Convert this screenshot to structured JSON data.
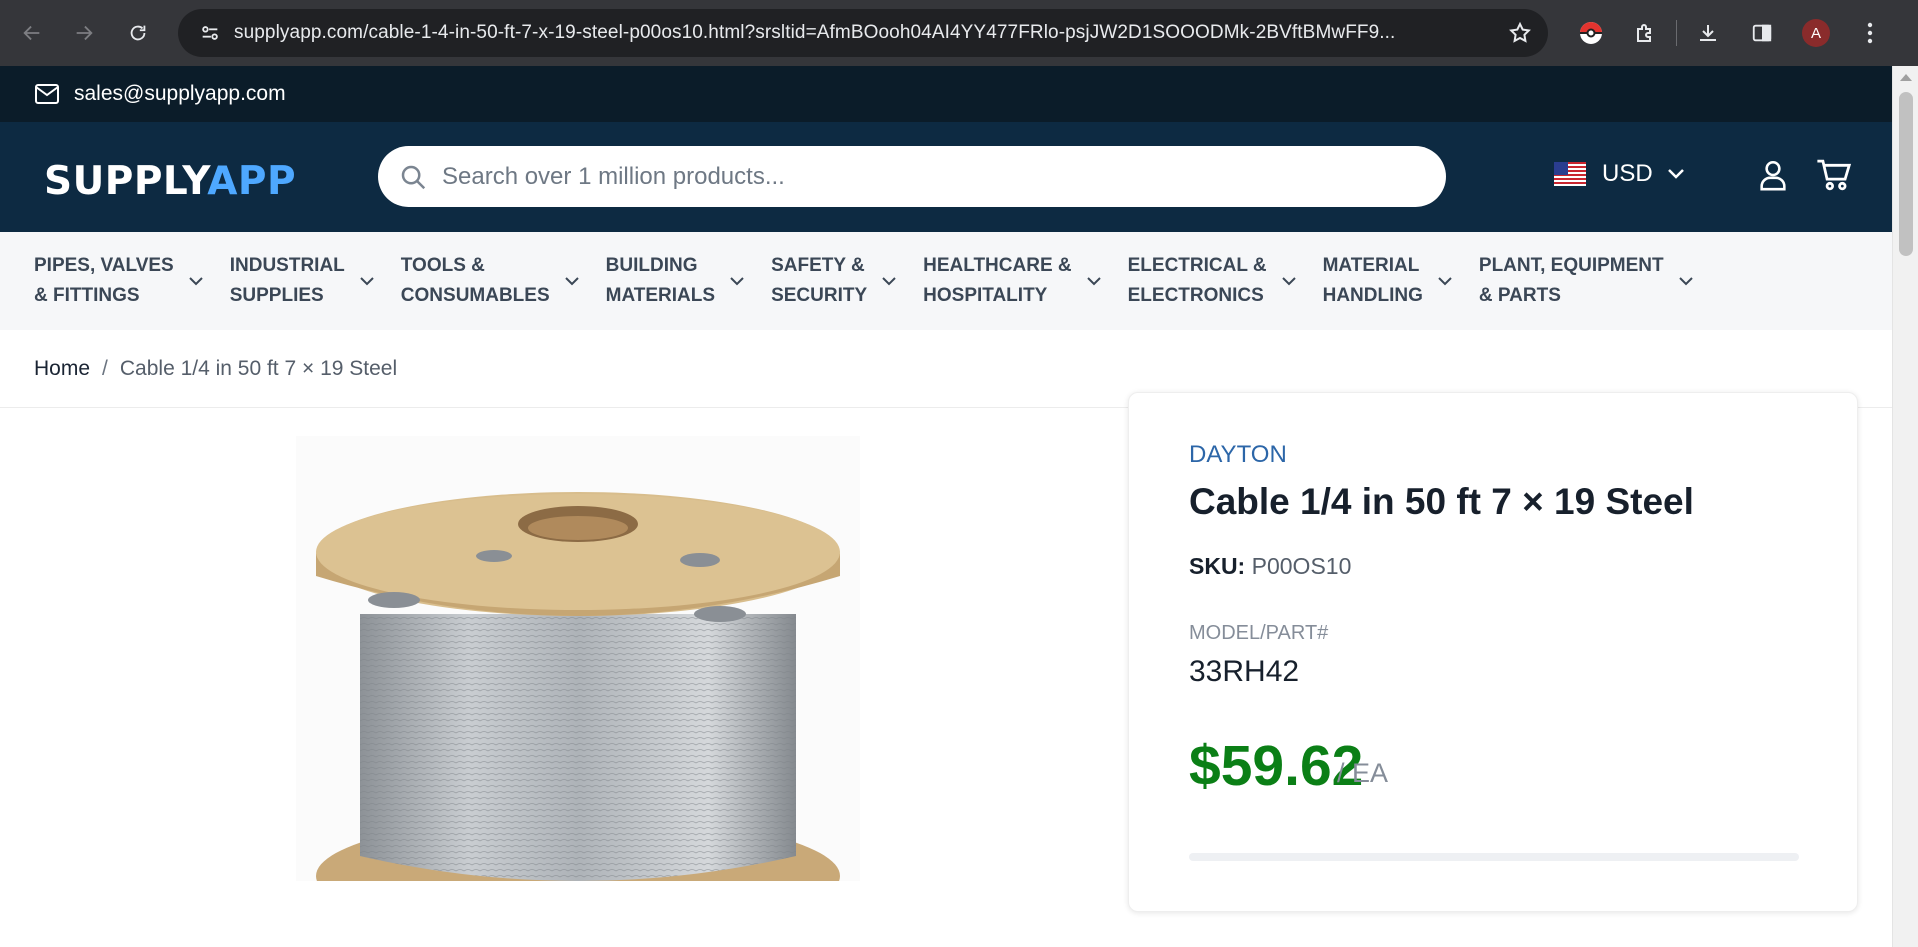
{
  "browser": {
    "url": "supplyapp.com/cable-1-4-in-50-ft-7-x-19-steel-p00os10.html?srsltid=AfmBOooh04AI4YY477FRlo-psjJW2D1SOOODMk-2BVftBMwFF9...",
    "profile_initial": "A"
  },
  "topbar": {
    "email": "sales@supplyapp.com"
  },
  "header": {
    "logo_main": "SUPPLY",
    "logo_accent": "APP",
    "search_placeholder": "Search over 1 million products...",
    "currency": "USD"
  },
  "categories": [
    {
      "label": "PIPES, VALVES\n& FITTINGS"
    },
    {
      "label": "INDUSTRIAL\nSUPPLIES"
    },
    {
      "label": "TOOLS &\nCONSUMABLES"
    },
    {
      "label": "BUILDING\nMATERIALS"
    },
    {
      "label": "SAFETY &\nSECURITY"
    },
    {
      "label": "HEALTHCARE &\nHOSPITALITY"
    },
    {
      "label": "ELECTRICAL &\nELECTRONICS"
    },
    {
      "label": "MATERIAL\nHANDLING"
    },
    {
      "label": "PLANT, EQUIPMENT\n& PARTS"
    }
  ],
  "breadcrumb": {
    "home": "Home",
    "separator": "/",
    "current": "Cable 1/4 in 50 ft 7 × 19 Steel"
  },
  "product": {
    "brand": "DAYTON",
    "title": "Cable 1/4 in 50 ft 7 × 19 Steel",
    "sku_label": "SKU:",
    "sku": "P00OS10",
    "model_label": "MODEL/PART#",
    "model": "33RH42",
    "price": "$59.62",
    "unit": "/ EA"
  },
  "colors": {
    "header_bg": "#0d2a42",
    "topbar_bg": "#0b1c29",
    "price_green": "#0b7f16",
    "brand_blue": "#2c66a8"
  }
}
